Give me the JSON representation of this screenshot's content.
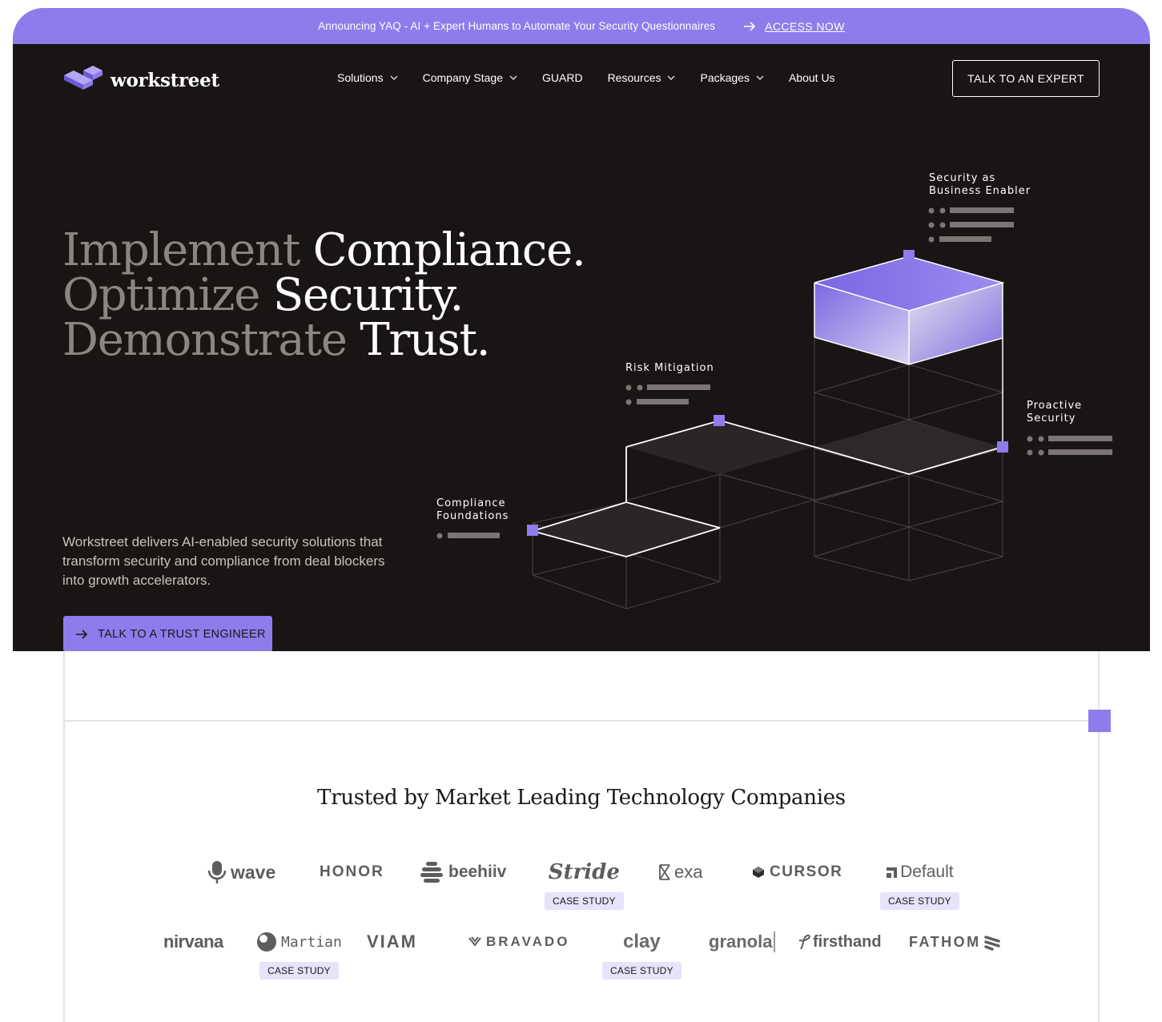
{
  "announcement": {
    "message": "Announcing YAQ - AI + Expert Humans to Automate Your Security Questionnaires",
    "link_label": "ACCESS NOW",
    "arrow_icon": "arrow-right-icon"
  },
  "brand": {
    "name": "workstreet",
    "logo_icon": "stacked-steps-logo"
  },
  "nav": {
    "items": [
      {
        "label": "Solutions",
        "has_dropdown": true
      },
      {
        "label": "Company Stage",
        "has_dropdown": true
      },
      {
        "label": "GUARD",
        "has_dropdown": false
      },
      {
        "label": "Resources",
        "has_dropdown": true
      },
      {
        "label": "Packages",
        "has_dropdown": true
      },
      {
        "label": "About Us",
        "has_dropdown": false
      }
    ],
    "cta": "TALK TO AN EXPERT"
  },
  "hero": {
    "headline": [
      {
        "dim": "Implement",
        "bright": "Compliance."
      },
      {
        "dim": "Optimize",
        "bright": "Security."
      },
      {
        "dim": "Demonstrate",
        "bright": "Trust."
      }
    ],
    "lede": "Workstreet delivers AI-enabled security solutions that transform security and compliance from deal blockers into growth accelerators.",
    "cta": "TALK TO A TRUST ENGINEER",
    "illustration_labels": {
      "security_enabler": "Security as\nBusiness Enabler",
      "risk": "Risk Mitigation",
      "proactive": "Proactive\nSecurity",
      "foundations": "Compliance\nFoundations"
    }
  },
  "trusted": {
    "title": "Trusted by Market Leading Technology Companies",
    "case_study_label": "CASE STUDY",
    "row1": [
      {
        "name": "wave",
        "case_study": false
      },
      {
        "name": "HONOR",
        "case_study": false
      },
      {
        "name": "beehiiv",
        "case_study": false
      },
      {
        "name": "Stride",
        "case_study": true
      },
      {
        "name": "exa",
        "case_study": false
      },
      {
        "name": "CURSOR",
        "case_study": false
      },
      {
        "name": "Default",
        "case_study": true
      }
    ],
    "row2": [
      {
        "name": "nirvana",
        "case_study": false
      },
      {
        "name": "Martian",
        "case_study": true
      },
      {
        "name": "VIAM",
        "case_study": false
      },
      {
        "name": "BRAVADO",
        "case_study": false
      },
      {
        "name": "clay",
        "case_study": true
      },
      {
        "name": "granola",
        "case_study": false
      },
      {
        "name": "firsthand",
        "case_study": false
      },
      {
        "name": "FATHOM",
        "case_study": false
      }
    ]
  },
  "colors": {
    "accent": "#8e7cec",
    "hero_bg": "#191515",
    "text_dim": "#8d8680"
  }
}
